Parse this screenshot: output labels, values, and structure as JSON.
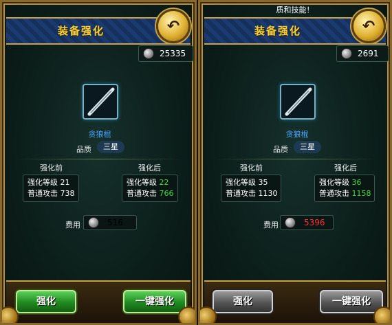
{
  "panels": [
    {
      "title": "装备强化",
      "notice": "",
      "currency": "25335",
      "item_name": "贪狼棍",
      "quality_label": "品质",
      "quality_value": "三星",
      "before_label": "强化前",
      "after_label": "强化后",
      "before": {
        "level_label": "强化等级",
        "level": "21",
        "attack_label": "普通攻击",
        "attack": "738"
      },
      "after": {
        "level_label": "强化等级",
        "level": "22",
        "attack_label": "普通攻击",
        "attack": "766"
      },
      "fee_label": "费用",
      "fee": "516",
      "fee_color": "#ffffff",
      "btn_enhance": "强化",
      "btn_auto": "一键强化",
      "buttons_enabled": true
    },
    {
      "title": "装备强化",
      "notice": "质和技能！",
      "currency": "2691",
      "item_name": "贪狼棍",
      "quality_label": "品质",
      "quality_value": "三星",
      "before_label": "强化前",
      "after_label": "强化后",
      "before": {
        "level_label": "强化等级",
        "level": "35",
        "attack_label": "普通攻击",
        "attack": "1130"
      },
      "after": {
        "level_label": "强化等级",
        "level": "36",
        "attack_label": "普通攻击",
        "attack": "1158"
      },
      "fee_label": "费用",
      "fee": "5396",
      "fee_color": "#ff3030",
      "btn_enhance": "强化",
      "btn_auto": "一键强化",
      "buttons_enabled": false
    }
  ],
  "icons": {
    "back": "back-arrow-icon",
    "coin": "silver-coin-icon",
    "item": "staff-weapon-icon"
  }
}
